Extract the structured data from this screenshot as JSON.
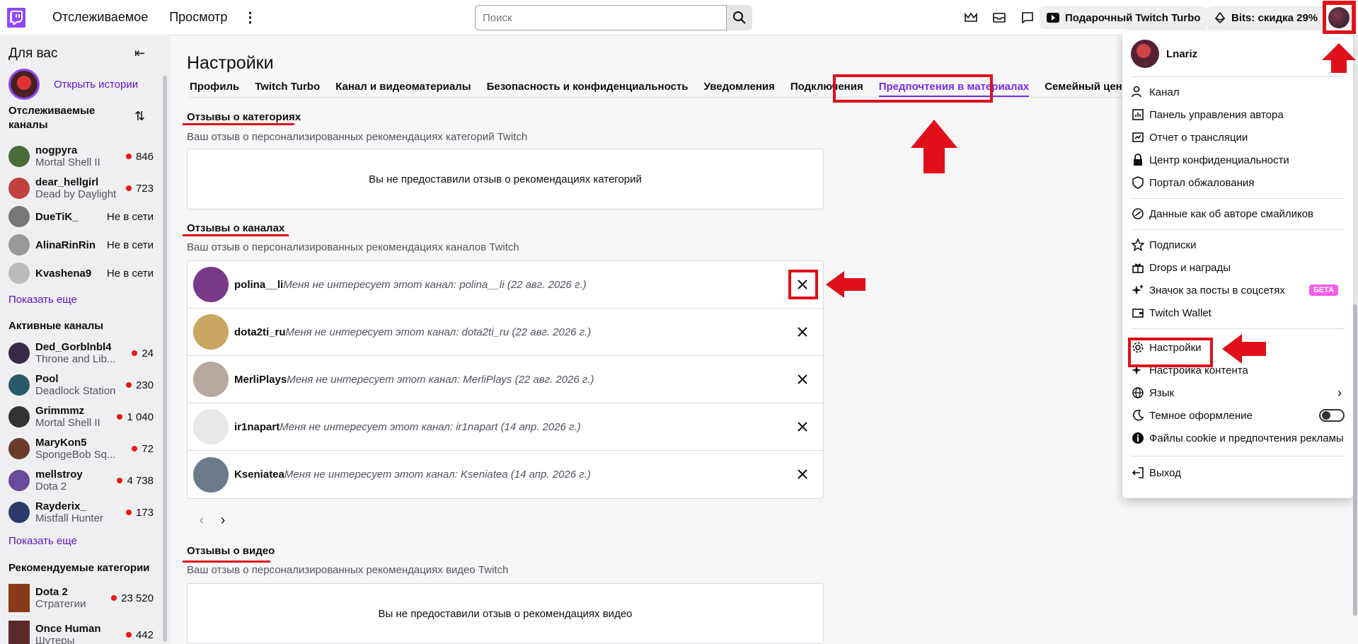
{
  "topbar": {
    "following": "Отслеживаемое",
    "browse": "Просмотр",
    "search_placeholder": "Поиск",
    "gift_turbo": "Подарочный Twitch Turbo",
    "bits_sale": "Bits: скидка 29%"
  },
  "sidebar": {
    "title": "Для вас",
    "open_stories": "Открыть истории",
    "followed_title": "Отслеживаемые каналы",
    "followed": [
      {
        "name": "nogpyra",
        "game": "Mortal Shell II",
        "viewers": "846",
        "live": true,
        "color": "#4a6b3a"
      },
      {
        "name": "dear_hellgirl",
        "game": "Dead by Daylight",
        "viewers": "723",
        "live": true,
        "color": "#c04040"
      },
      {
        "name": "DueTiK_",
        "game": "",
        "viewers": "Не в сети",
        "live": false,
        "color": "#777"
      },
      {
        "name": "AlinaRinRin",
        "game": "",
        "viewers": "Не в сети",
        "live": false,
        "color": "#999"
      },
      {
        "name": "Kvashena9",
        "game": "",
        "viewers": "Не в сети",
        "live": false,
        "color": "#bbb"
      }
    ],
    "show_more_1": "Показать еще",
    "active_title": "Активные каналы",
    "active": [
      {
        "name": "Ded_Gorblnbl4",
        "game": "Throne and Lib...",
        "viewers": "24",
        "color": "#3a2a4a"
      },
      {
        "name": "Pool",
        "game": "Deadlock Station",
        "viewers": "230",
        "color": "#2a5a6a"
      },
      {
        "name": "Grimmmz",
        "game": "Mortal Shell II",
        "viewers": "1 040",
        "color": "#333"
      },
      {
        "name": "MaryKon5",
        "game": "SpongeBob Sq...",
        "viewers": "72",
        "color": "#6a3a2a"
      },
      {
        "name": "mellstroy",
        "game": "Dota 2",
        "viewers": "4 738",
        "color": "#6a4a9a"
      },
      {
        "name": "Rayderix_",
        "game": "Mistfall Hunter",
        "viewers": "173",
        "color": "#2a3a6a"
      }
    ],
    "show_more_2": "Показать еще",
    "categories_title": "Рекомендуемые категории",
    "categories": [
      {
        "name": "Dota 2",
        "tag": "Стратегии",
        "viewers": "23 520",
        "color": "#8a3a1a"
      },
      {
        "name": "Once Human",
        "tag": "Шутеры",
        "viewers": "442",
        "color": "#5a2a2a"
      }
    ]
  },
  "main": {
    "title": "Настройки",
    "tabs": [
      "Профиль",
      "Twitch Turbo",
      "Канал и видеоматериалы",
      "Безопасность и конфиденциальность",
      "Уведомления",
      "Подключения",
      "Предпочтения в материалах",
      "Семейный центр"
    ],
    "cat_title": "Отзывы о категориях",
    "cat_sub": "Ваш отзыв о персонализированных рекомендациях категорий Twitch",
    "cat_empty": "Вы не предоставили отзыв о рекомендациях категорий",
    "ch_title": "Отзывы о каналах",
    "ch_sub": "Ваш отзыв о персонализированных рекомендациях каналов Twitch",
    "channels": [
      {
        "name": "polina__li",
        "desc": "Меня не интересует этот канал: polina__li (22 авг. 2026 г.)",
        "color": "#7a3a8a"
      },
      {
        "name": "dota2ti_ru",
        "desc": "Меня не интересует этот канал: dota2ti_ru (22 авг. 2026 г.)",
        "color": "#c8a860"
      },
      {
        "name": "MerliPlays",
        "desc": "Меня не интересует этот канал: MerliPlays (22 авг. 2026 г.)",
        "color": "#b8a8a0"
      },
      {
        "name": "ir1napart",
        "desc": "Меня не интересует этот канал: ir1napart (14 апр. 2026 г.)",
        "color": "#e8e8e8"
      },
      {
        "name": "Kseniatea",
        "desc": "Меня не интересует этот канал: Kseniatea (14 апр. 2026 г.)",
        "color": "#6a7a8a"
      }
    ],
    "vid_title": "Отзывы о видео",
    "vid_sub": "Ваш отзыв о персонализированных рекомендациях видео Twitch",
    "vid_empty": "Вы не предоставили отзыв о рекомендациях видео"
  },
  "menu": {
    "username": "Lnariz",
    "items": [
      "Канал",
      "Панель управления автора",
      "Отчет о трансляции",
      "Центр конфиденциальности",
      "Портал обжалования",
      "Данные как об авторе смайликов",
      "Подписки",
      "Drops и награды",
      "Значок за посты в соцсетях",
      "Twitch Wallet",
      "Настройки",
      "Настройка контента",
      "Язык",
      "Темное оформление",
      "Файлы cookie и предпочтения рекламы",
      "Выход"
    ],
    "beta": "БЕТА"
  },
  "colors": {
    "accent": "#9147ff",
    "annotation": "#e0101a",
    "live": "#e91916"
  }
}
